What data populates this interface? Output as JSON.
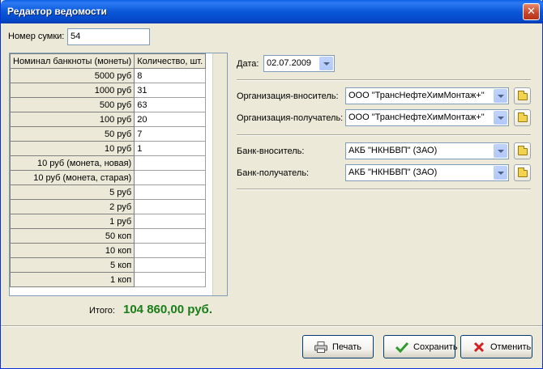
{
  "window": {
    "title": "Редактор ведомости",
    "close_glyph": "✕"
  },
  "bag": {
    "label": "Номер сумки:",
    "value": "54"
  },
  "grid": {
    "headers": [
      "Номинал банкноты (монеты)",
      "Количество, шт."
    ],
    "rows": [
      {
        "nominal": "5000 руб",
        "qty": "8"
      },
      {
        "nominal": "1000 руб",
        "qty": "31"
      },
      {
        "nominal": "500 руб",
        "qty": "63"
      },
      {
        "nominal": "100 руб",
        "qty": "20"
      },
      {
        "nominal": "50 руб",
        "qty": "7"
      },
      {
        "nominal": "10 руб",
        "qty": "1"
      },
      {
        "nominal": "10 руб (монета, новая)",
        "qty": ""
      },
      {
        "nominal": "10 руб (монета, старая)",
        "qty": ""
      },
      {
        "nominal": "5 руб",
        "qty": ""
      },
      {
        "nominal": "2 руб",
        "qty": ""
      },
      {
        "nominal": "1 руб",
        "qty": ""
      },
      {
        "nominal": "50 коп",
        "qty": ""
      },
      {
        "nominal": "10 коп",
        "qty": ""
      },
      {
        "nominal": "5 коп",
        "qty": ""
      },
      {
        "nominal": "1 коп",
        "qty": ""
      }
    ]
  },
  "total": {
    "label": "Итого:",
    "value": "104 860,00 руб.",
    "color": "#1a7d1a"
  },
  "form": {
    "date": {
      "label": "Дата:",
      "value": "02.07.2009"
    },
    "org_sender": {
      "label": "Организация-вноситель:",
      "value": "ООО \"ТрансНефтеХимМонтаж+\""
    },
    "org_receiver": {
      "label": "Организация-получатель:",
      "value": "ООО \"ТрансНефтеХимМонтаж+\""
    },
    "bank_sender": {
      "label": "Банк-вноситель:",
      "value": "АКБ \"НКНБВП\" (ЗАО)"
    },
    "bank_receiver": {
      "label": "Банк-получатель:",
      "value": "АКБ \"НКНБВП\" (ЗАО)"
    }
  },
  "buttons": {
    "print": {
      "label": "Печать",
      "icon": "printer-icon"
    },
    "save": {
      "label": "Сохранить",
      "icon": "checkmark-icon",
      "icon_color": "#2e9b2e"
    },
    "cancel": {
      "label": "Отменить",
      "icon": "x-icon",
      "icon_color": "#d42020"
    }
  }
}
